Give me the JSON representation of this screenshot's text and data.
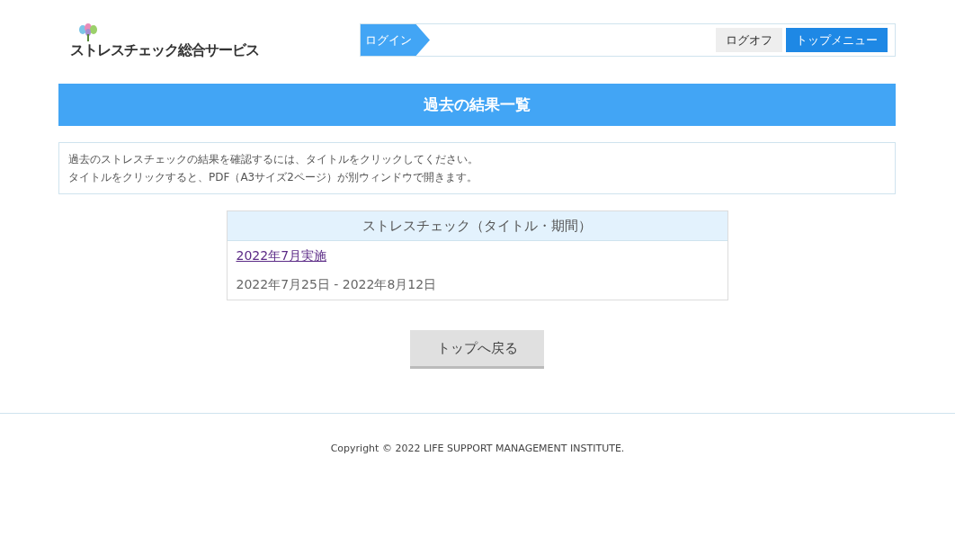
{
  "logo": {
    "text": "ストレスチェック総合サービス"
  },
  "breadcrumb": [
    {
      "label": "ログイン"
    }
  ],
  "nav_buttons": [
    {
      "label": "ログオフ",
      "kind": "plain"
    },
    {
      "label": "トップメニュー",
      "kind": "primary"
    }
  ],
  "page_title": "過去の結果一覧",
  "info_lines": [
    "過去のストレスチェックの結果を確認するには、タイトルをクリックしてください。",
    "タイトルをクリックすると、PDF（A3サイズ2ページ）が別ウィンドウで開きます。"
  ],
  "table": {
    "header": "ストレスチェック（タイトル・期間）",
    "rows": [
      {
        "title": "2022年7月実施",
        "period": "2022年7月25日 - 2022年8月12日"
      }
    ]
  },
  "back_button": "トップへ戻る",
  "footer": "Copyright © 2022 LIFE SUPPORT MANAGEMENT INSTITUTE."
}
